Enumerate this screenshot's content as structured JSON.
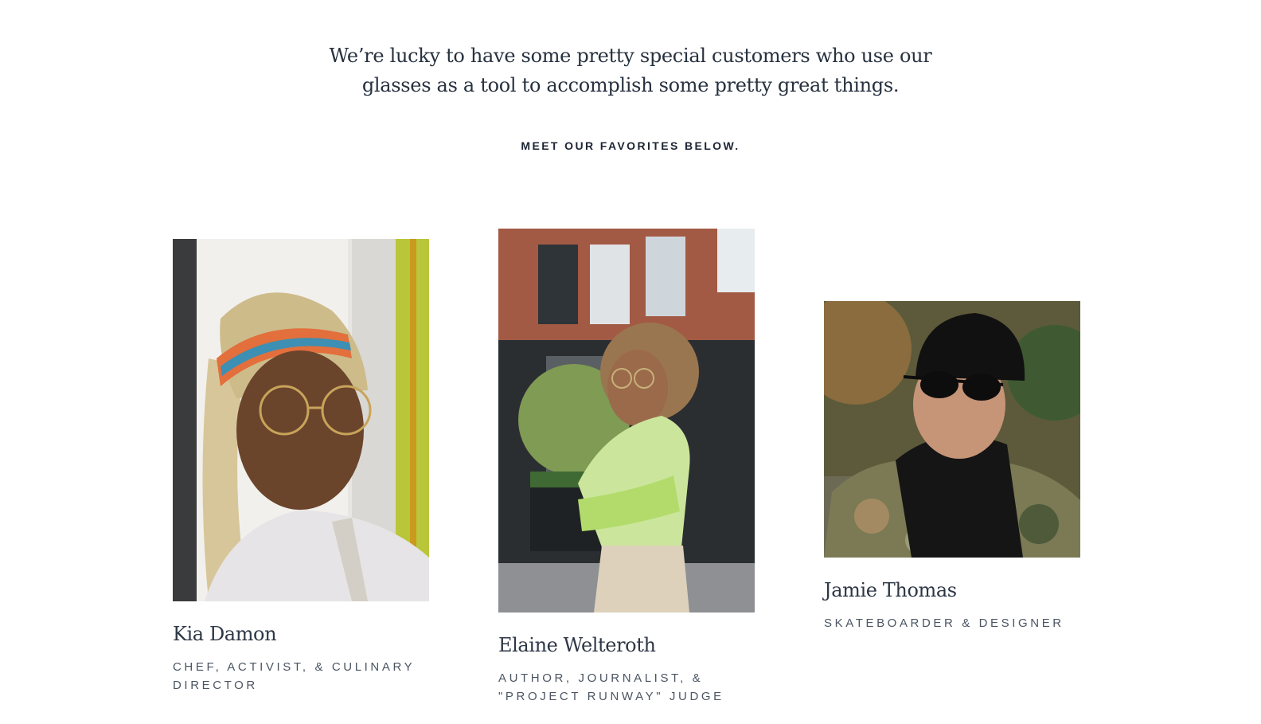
{
  "intro": {
    "text": "We’re lucky to have some pretty special customers who use our glasses as a tool to accomplish some pretty great things.",
    "cta": "MEET OUR FAVORITES BELOW."
  },
  "people": [
    {
      "name": "Kia Damon",
      "role": "CHEF, ACTIVIST, & CULINARY DIRECTOR",
      "photo": "portrait-with-round-glasses"
    },
    {
      "name": "Elaine Welteroth",
      "role": "AUTHOR, JOURNALIST, & \"PROJECT RUNWAY\" JUDGE",
      "photo": "street-portrait-with-glasses"
    },
    {
      "name": "Jamie Thomas",
      "role": "SKATEBOARDER & DESIGNER",
      "photo": "portrait-with-sunglasses"
    }
  ],
  "colors": {
    "text": "#27313f",
    "background": "#ffffff"
  }
}
